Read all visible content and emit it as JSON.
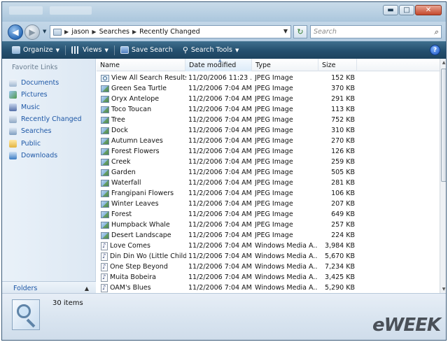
{
  "titlebar": {
    "ghost_left": "Windows",
    "ghost_right": "Search Results"
  },
  "address": {
    "crumbs": [
      "jason",
      "Searches",
      "Recently Changed"
    ],
    "search_placeholder": "Search"
  },
  "toolbar": {
    "organize": "Organize",
    "views": "Views",
    "save_search": "Save Search",
    "search_tools": "Search Tools",
    "help": "?"
  },
  "navpane": {
    "heading": "Favorite Links",
    "items": [
      {
        "label": "Documents",
        "icon": "documents-icon"
      },
      {
        "label": "Pictures",
        "icon": "pictures-icon"
      },
      {
        "label": "Music",
        "icon": "music-icon"
      },
      {
        "label": "Recently Changed",
        "icon": "recently-changed-icon"
      },
      {
        "label": "Searches",
        "icon": "searches-icon"
      },
      {
        "label": "Public",
        "icon": "public-folder-icon"
      },
      {
        "label": "Downloads",
        "icon": "downloads-icon"
      }
    ],
    "folders_label": "Folders"
  },
  "columns": {
    "name": "Name",
    "date": "Date modified",
    "type": "Type",
    "size": "Size"
  },
  "files": [
    {
      "name": "View All Search Results",
      "date": "11/20/2006 11:23 ...",
      "type": "JPEG Image",
      "size": "152 KB",
      "icon": "search-file-icon"
    },
    {
      "name": "Green Sea Turtle",
      "date": "11/2/2006 7:04 AM",
      "type": "JPEG Image",
      "size": "370 KB",
      "icon": "jpeg-file-icon"
    },
    {
      "name": "Oryx Antelope",
      "date": "11/2/2006 7:04 AM",
      "type": "JPEG Image",
      "size": "291 KB",
      "icon": "jpeg-file-icon"
    },
    {
      "name": "Toco Toucan",
      "date": "11/2/2006 7:04 AM",
      "type": "JPEG Image",
      "size": "113 KB",
      "icon": "jpeg-file-icon"
    },
    {
      "name": "Tree",
      "date": "11/2/2006 7:04 AM",
      "type": "JPEG Image",
      "size": "752 KB",
      "icon": "jpeg-file-icon"
    },
    {
      "name": "Dock",
      "date": "11/2/2006 7:04 AM",
      "type": "JPEG Image",
      "size": "310 KB",
      "icon": "jpeg-file-icon"
    },
    {
      "name": "Autumn Leaves",
      "date": "11/2/2006 7:04 AM",
      "type": "JPEG Image",
      "size": "270 KB",
      "icon": "jpeg-file-icon"
    },
    {
      "name": "Forest Flowers",
      "date": "11/2/2006 7:04 AM",
      "type": "JPEG Image",
      "size": "126 KB",
      "icon": "jpeg-file-icon"
    },
    {
      "name": "Creek",
      "date": "11/2/2006 7:04 AM",
      "type": "JPEG Image",
      "size": "259 KB",
      "icon": "jpeg-file-icon"
    },
    {
      "name": "Garden",
      "date": "11/2/2006 7:04 AM",
      "type": "JPEG Image",
      "size": "505 KB",
      "icon": "jpeg-file-icon"
    },
    {
      "name": "Waterfall",
      "date": "11/2/2006 7:04 AM",
      "type": "JPEG Image",
      "size": "281 KB",
      "icon": "jpeg-file-icon"
    },
    {
      "name": "Frangipani Flowers",
      "date": "11/2/2006 7:04 AM",
      "type": "JPEG Image",
      "size": "106 KB",
      "icon": "jpeg-file-icon"
    },
    {
      "name": "Winter Leaves",
      "date": "11/2/2006 7:04 AM",
      "type": "JPEG Image",
      "size": "207 KB",
      "icon": "jpeg-file-icon"
    },
    {
      "name": "Forest",
      "date": "11/2/2006 7:04 AM",
      "type": "JPEG Image",
      "size": "649 KB",
      "icon": "jpeg-file-icon"
    },
    {
      "name": "Humpback Whale",
      "date": "11/2/2006 7:04 AM",
      "type": "JPEG Image",
      "size": "257 KB",
      "icon": "jpeg-file-icon"
    },
    {
      "name": "Desert Landscape",
      "date": "11/2/2006 7:04 AM",
      "type": "JPEG Image",
      "size": "224 KB",
      "icon": "jpeg-file-icon"
    },
    {
      "name": "Love Comes",
      "date": "11/2/2006 7:04 AM",
      "type": "Windows Media A...",
      "size": "3,984 KB",
      "icon": "audio-file-icon"
    },
    {
      "name": "Din Din Wo (Little Child)",
      "date": "11/2/2006 7:04 AM",
      "type": "Windows Media A...",
      "size": "5,670 KB",
      "icon": "audio-file-icon"
    },
    {
      "name": "One Step Beyond",
      "date": "11/2/2006 7:04 AM",
      "type": "Windows Media A...",
      "size": "7,234 KB",
      "icon": "audio-file-icon"
    },
    {
      "name": "Muita Bobeira",
      "date": "11/2/2006 7:04 AM",
      "type": "Windows Media A...",
      "size": "3,425 KB",
      "icon": "audio-file-icon"
    },
    {
      "name": "OAM's Blues",
      "date": "11/2/2006 7:04 AM",
      "type": "Windows Media A...",
      "size": "5,290 KB",
      "icon": "audio-file-icon"
    }
  ],
  "details": {
    "count": "30 items"
  },
  "watermark": "eWEEK",
  "colors": {
    "toolbar": "#244f6e",
    "link": "#1d57a6",
    "titlebar": "#b7cfe2"
  }
}
